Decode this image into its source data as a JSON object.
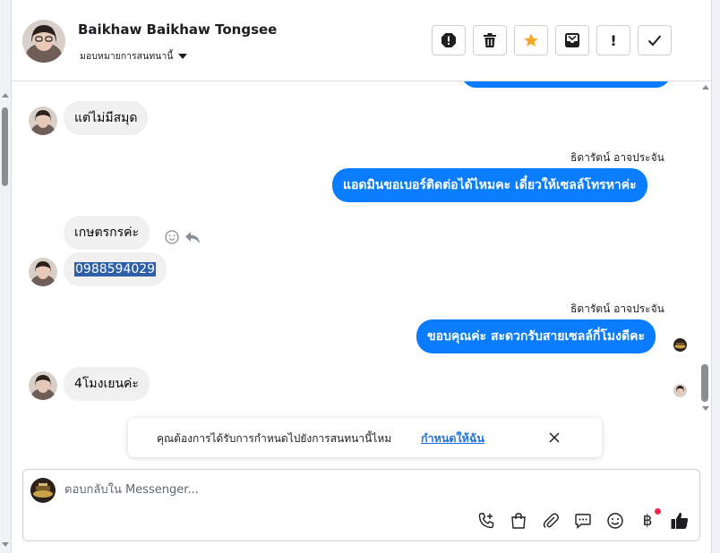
{
  "header": {
    "contact_name": "Baikhaw Baikhaw Tongsee",
    "assign_label": "มอบหมายการสนทนานี้",
    "actions": [
      {
        "name": "report-spam-button",
        "icon": "alert-circle-icon"
      },
      {
        "name": "delete-button",
        "icon": "trash-icon"
      },
      {
        "name": "star-button",
        "icon": "star-icon"
      },
      {
        "name": "move-to-inbox-button",
        "icon": "inbox-icon"
      },
      {
        "name": "mark-follow-up-button",
        "icon": "exclamation-icon",
        "glyph": "!"
      },
      {
        "name": "mark-done-button",
        "icon": "check-icon"
      }
    ]
  },
  "thread": {
    "messages": [
      {
        "dir": "in",
        "text": "แต่ไม่มีสมุด"
      },
      {
        "dir": "out",
        "sender": "ธิดารัตน์ อาจประจัน",
        "text": "แอดมินขอเบอร์ติดต่อได้ไหมคะ เดี๋ยวให้เซลล์โทรหาค่ะ"
      },
      {
        "dir": "in",
        "text": "เกษตรกรค่ะ"
      },
      {
        "dir": "in",
        "text": "0988594029",
        "selected": true
      },
      {
        "dir": "out",
        "sender": "ธิดารัตน์ อาจประจัน",
        "text": "ขอบคุณค่ะ สะดวกรับสายเซลล์กี่โมงดีคะ"
      },
      {
        "dir": "in",
        "text": "4โมงเยนค่ะ"
      }
    ]
  },
  "toast": {
    "text": "คุณต้องการได้รับการกำหนดไปยังการสนทนานี้ไหม",
    "link": "กำหนดให้ฉัน"
  },
  "composer": {
    "placeholder": "ตอบกลับใน Messenger...",
    "tools": [
      {
        "name": "call-add-icon"
      },
      {
        "name": "shopping-bag-icon"
      },
      {
        "name": "paperclip-icon"
      },
      {
        "name": "saved-replies-icon"
      },
      {
        "name": "emoji-icon"
      },
      {
        "name": "baht-payment-icon",
        "glyph": "฿"
      },
      {
        "name": "thumbs-up-icon"
      }
    ]
  },
  "colors": {
    "outgoing_bubble": "#0a7cff",
    "incoming_bubble": "#f0f0f0",
    "star": "#f5a623",
    "link": "#216fdb",
    "selection": "#2e5fa8",
    "notification_dot": "#f02849"
  }
}
